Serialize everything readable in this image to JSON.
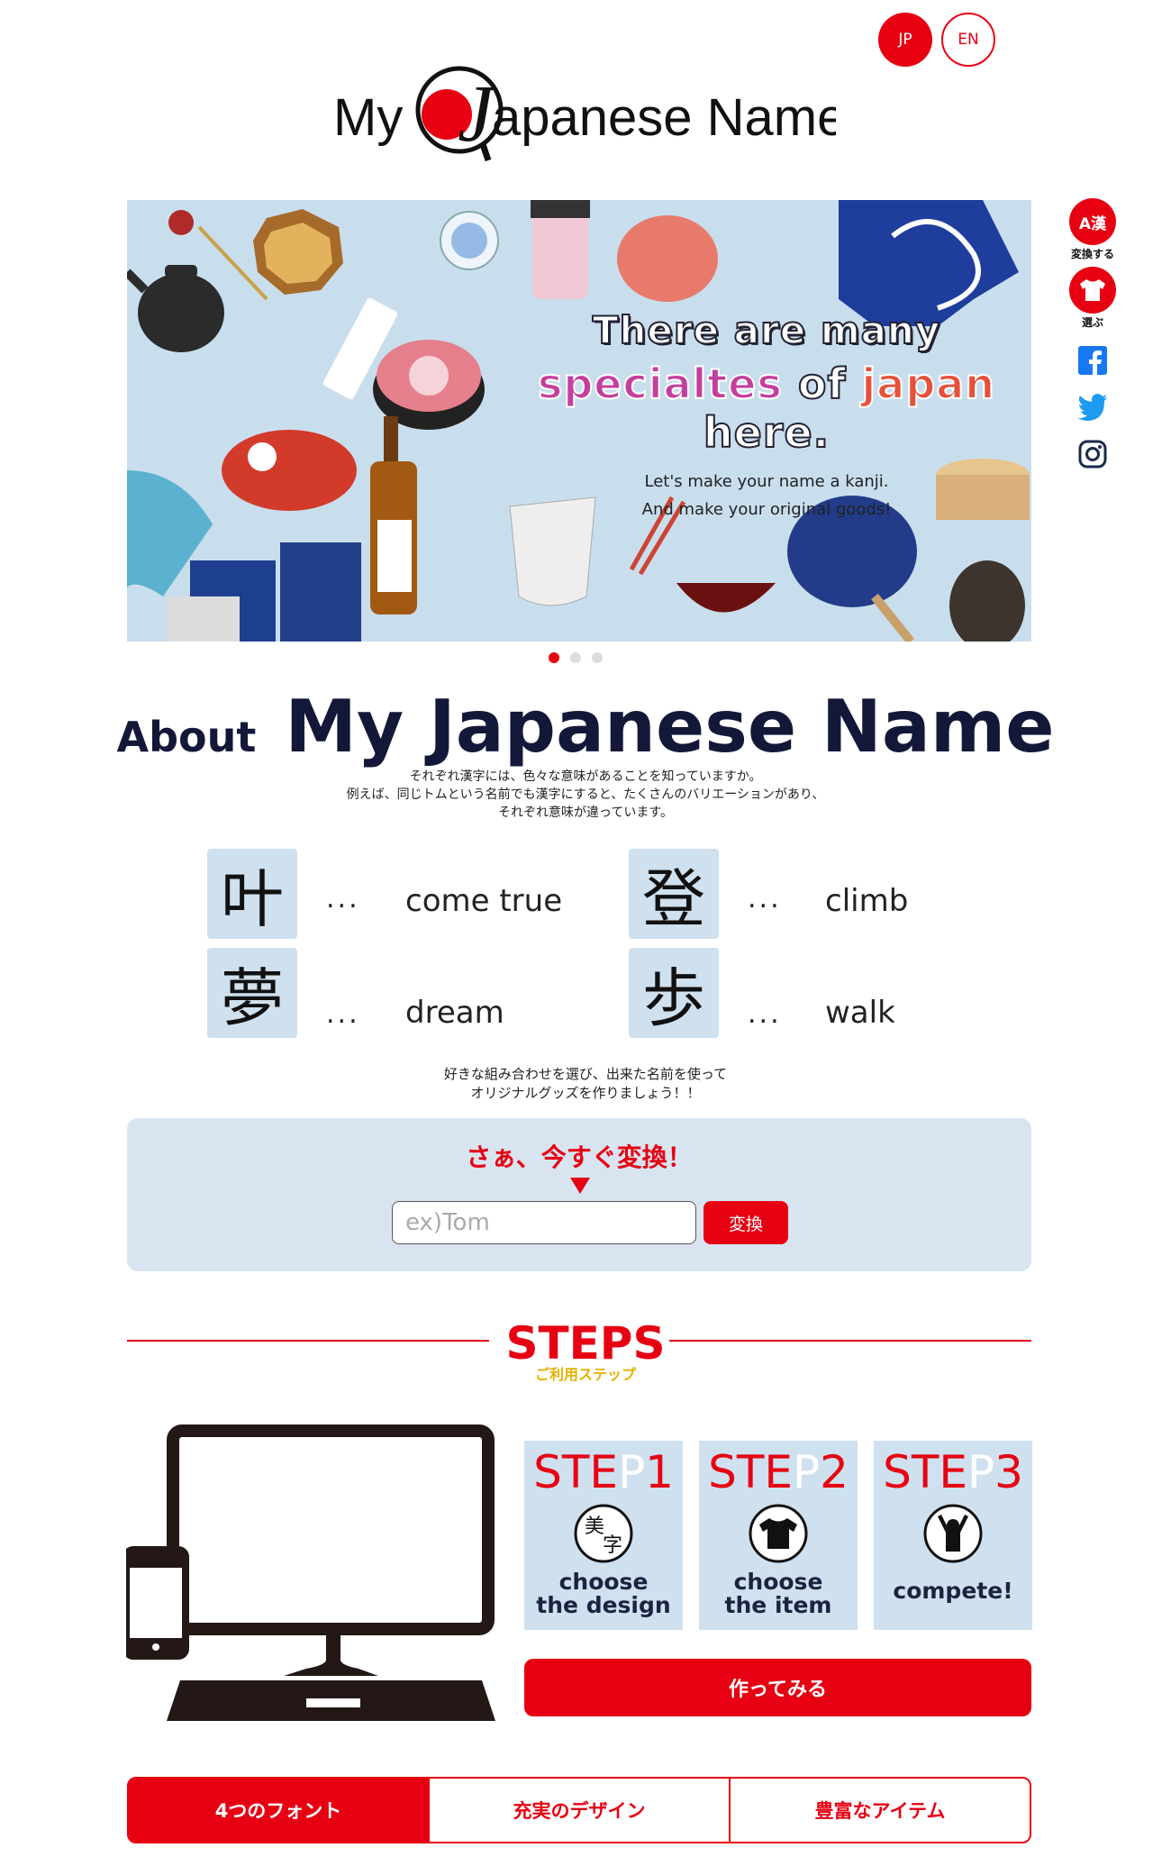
{
  "language_switch": {
    "jp": "JP",
    "en": "EN"
  },
  "logo": {
    "text_my": "My",
    "text_rest": "apanese Name",
    "letter": "J"
  },
  "side_rail": {
    "convert_icon_text": "A漢",
    "convert_label": "変換する",
    "shirt_label": "選ぶ",
    "social": [
      "facebook",
      "twitter",
      "instagram"
    ]
  },
  "hero": {
    "line1": "There are many",
    "line2_a": "specialtes",
    "line2_b": " of ",
    "line2_c": "japan",
    "line2_d": " here.",
    "sub1": "Let's make your name a kanji.",
    "sub2": "And make your original goods!",
    "slides": 3,
    "active_slide": 0
  },
  "about": {
    "small": "About",
    "big": "My Japanese Name",
    "desc1": "それぞれ漢字には、色々な意味があることを知っていますか。",
    "desc2": "例えば、同じトムという名前でも漢字にすると、たくさんのバリエーションがあり、",
    "desc3": "それぞれ意味が違っています。"
  },
  "kanji_examples": [
    {
      "kanji": "叶",
      "dots": "...",
      "meaning": "come true"
    },
    {
      "kanji": "登",
      "dots": "...",
      "meaning": "climb"
    },
    {
      "kanji": "夢",
      "dots": "...",
      "meaning": "dream"
    },
    {
      "kanji": "歩",
      "dots": "...",
      "meaning": "walk"
    }
  ],
  "howto": {
    "line1": "好きな組み合わせを選び、出来た名前を使って",
    "line2": "オリジナルグッズを作りましょう！！"
  },
  "convert": {
    "heading": "さぁ、今すぐ変換！",
    "placeholder": "ex)Tom",
    "button": "変換"
  },
  "steps": {
    "title": "STEPS",
    "subtitle": "ご利用ステップ",
    "items": [
      {
        "a": "STE",
        "b": "P",
        "c": "1",
        "label1": "choose",
        "label2": "the design"
      },
      {
        "a": "STE",
        "b": "P",
        "c": "2",
        "label1": "choose",
        "label2": "the item"
      },
      {
        "a": "STE",
        "b": "P",
        "c": "3",
        "label1": "compete!",
        "label2": ""
      }
    ],
    "cta": "作ってみる"
  },
  "tabs": [
    "4つのフォント",
    "充実のデザイン",
    "豊富なアイテム"
  ],
  "colors": {
    "accent": "#e60012",
    "navy": "#141838",
    "panel": "#d8e5f1",
    "gold": "#e4b100"
  }
}
